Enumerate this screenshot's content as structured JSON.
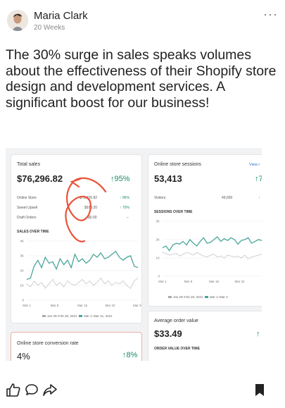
{
  "post": {
    "author": "Maria Clark",
    "time": "20 Weeks",
    "text": "The 30% surge in sales speaks volumes about the effectiveness of their Shopify store design and development services. A significant boost for our business!"
  },
  "icons": {
    "more": "more-options-icon",
    "like": "thumbs-up-icon",
    "comment": "comment-icon",
    "share": "share-icon",
    "bookmark": "bookmark-icon"
  },
  "colors": {
    "positive": "#1c8a6a",
    "series_current": "#4aa59b",
    "series_previous": "#a8aab0",
    "annotation": "#e8543a",
    "link": "#2c6ecb"
  },
  "dashboard": {
    "total_sales": {
      "title": "Total sales",
      "value": "$76,296.82",
      "change": "↑95%",
      "rows": [
        {
          "label": "Online Store",
          "value": "$75,326.82",
          "change": "↑ 96%"
        },
        {
          "label": "Sweet Upsell",
          "value": "$970.20",
          "change": "↑ 70%"
        },
        {
          "label": "Draft Orders",
          "value": "$0.00",
          "change": "–"
        }
      ],
      "chart_title": "SALES OVER TIME",
      "legend_prev": "Jan 29–Feb 28, 2021",
      "legend_curr": "Mar 1–Mar 31, 2021"
    },
    "sessions": {
      "title": "Online store sessions",
      "link": "View r",
      "value": "53,413",
      "change": "↑7",
      "row_label": "Visitors",
      "row_value": "49,650",
      "row_change": "↑",
      "chart_title": "SESSIONS OVER TIME",
      "legend_prev": "Jan 29–Feb 28, 2021",
      "legend_curr": "Mar 1–Mar 3"
    },
    "aov": {
      "title": "Average order value",
      "value": "$33.49",
      "change": "↑",
      "chart_title": "ORDER VALUE OVER TIME"
    },
    "conversion": {
      "title": "Online store conversion rate",
      "value": "4%",
      "change": "↑8%"
    }
  },
  "chart_data": [
    {
      "type": "line",
      "title": "SALES OVER TIME",
      "x": [
        "Mar 1",
        "Mar 8",
        "Mar 15",
        "Mar 22",
        "Mar 29"
      ],
      "ylim": [
        0,
        4000
      ],
      "yticks": [
        "0",
        "1K",
        "2K",
        "3K",
        "4K"
      ],
      "series": [
        {
          "name": "Mar 1–Mar 31, 2021",
          "values": [
            1400,
            1500,
            2300,
            2700,
            2200,
            2900,
            2500,
            2600,
            2100,
            2800,
            2400,
            2700,
            2200,
            3100,
            2600,
            2800,
            2500,
            2700,
            3100,
            2900,
            3200,
            2800,
            2900,
            3100,
            3300,
            2900,
            2700,
            2900,
            3000,
            2300,
            2200
          ]
        },
        {
          "name": "Jan 29–Feb 28, 2021",
          "values": [
            1100,
            900,
            1300,
            1000,
            1200,
            800,
            1100,
            1400,
            1000,
            1200,
            900,
            1300,
            1100,
            1000,
            1200,
            1400,
            1100,
            1300,
            1000,
            1200,
            1500,
            1100,
            1300,
            1000,
            1200,
            1100,
            1300,
            1000,
            800,
            1300,
            1500
          ]
        }
      ]
    },
    {
      "type": "line",
      "title": "SESSIONS OVER TIME",
      "x": [
        "Mar 1",
        "Mar 8",
        "Mar 15",
        "Mar 22",
        "Mar"
      ],
      "ylim": [
        0,
        3000
      ],
      "yticks": [
        "0",
        "1K",
        "2K",
        "3K"
      ],
      "series": [
        {
          "name": "Mar 1–Mar 3",
          "values": [
            1550,
            1650,
            1400,
            1700,
            1800,
            1750,
            1900,
            1700,
            2000,
            1800,
            1650,
            1900,
            2100,
            1800,
            1850,
            2000,
            2150,
            1900,
            2050,
            1950,
            2100,
            2000,
            1750,
            1950,
            2000,
            2100,
            1800,
            1900,
            2000,
            1950,
            2050
          ]
        },
        {
          "name": "Jan 29–Feb 28, 2021",
          "values": [
            1300,
            1250,
            1150,
            1200,
            1250,
            1100,
            1200,
            1300,
            1250,
            1150,
            1300,
            1200,
            1100,
            1050,
            1150,
            1200,
            1050,
            1100,
            1000,
            1150,
            1100,
            1050,
            1100,
            1000,
            1150,
            950,
            1050,
            1100,
            1150,
            1200,
            1100
          ]
        }
      ]
    }
  ]
}
